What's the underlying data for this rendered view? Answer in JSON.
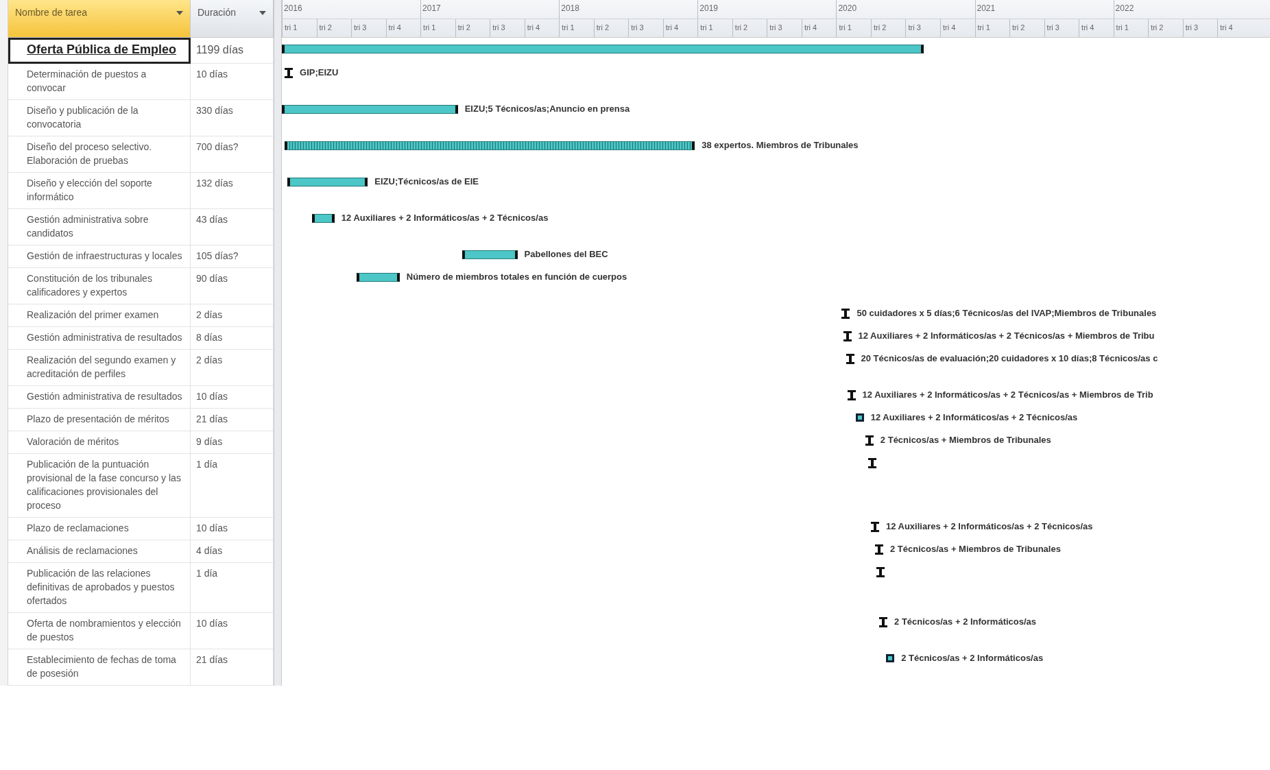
{
  "table": {
    "columns": [
      {
        "label": "Nombre de tarea",
        "selected": true
      },
      {
        "label": "Duración",
        "selected": false
      }
    ]
  },
  "timescale": {
    "years": [
      {
        "label": "2016",
        "quarters": [
          "tri 1",
          "tri 2",
          "tri 3",
          "tri 4"
        ]
      },
      {
        "label": "2017",
        "quarters": [
          "tri 1",
          "tri 2",
          "tri 3",
          "tri 4"
        ]
      },
      {
        "label": "2018",
        "quarters": [
          "tri 1",
          "tri 2",
          "tri 3",
          "tri 4"
        ]
      },
      {
        "label": "2019",
        "quarters": [
          "tri 1",
          "tri 2",
          "tri 3",
          "tri 4"
        ]
      },
      {
        "label": "2020",
        "quarters": [
          "tri 1",
          "tri 2",
          "tri 3",
          "tri 4"
        ]
      },
      {
        "label": "2021",
        "quarters": [
          "tri 1",
          "tri 2",
          "tri 3",
          "tri 4"
        ]
      },
      {
        "label": "2022",
        "quarters": [
          "tri 1",
          "tri 2",
          "tri 3",
          "tri 4"
        ]
      }
    ]
  },
  "tasks": [
    {
      "name": "Oferta Pública de Empleo",
      "duration": "1199 días",
      "kind": "summary",
      "selected": true
    },
    {
      "name": "Determinación de puestos a convocar",
      "duration": "10 días",
      "kind": "short",
      "resources": "GIP;EIZU",
      "selected": false
    },
    {
      "name": "Diseño y publicación de la convocatoria",
      "duration": "330 días",
      "kind": "task",
      "resources": "EIZU;5 Técnicos/as;Anuncio en prensa",
      "selected": false
    },
    {
      "name": "Diseño del proceso selectivo. Elaboración de pruebas",
      "duration": "700 días?",
      "kind": "hatched",
      "resources": "38 expertos. Miembros de Tribunales",
      "selected": false
    },
    {
      "name": "Diseño y elección del soporte informático",
      "duration": "132 días",
      "kind": "task",
      "resources": "EIZU;Técnicos/as de EIE",
      "selected": false
    },
    {
      "name": "Gestión administrativa sobre candidatos",
      "duration": "43 días",
      "kind": "task",
      "resources": "12 Auxiliares + 2 Informáticos/as + 2 Técnicos/as",
      "selected": false
    },
    {
      "name": "Gestión de infraestructuras y locales",
      "duration": "105 días?",
      "kind": "task",
      "resources": "Pabellones del BEC",
      "selected": false
    },
    {
      "name": "Constitución de los tribunales calificadores y expertos",
      "duration": "90 días",
      "kind": "task",
      "resources": "Número de miembros totales en función de cuerpos",
      "selected": false
    },
    {
      "name": "Realización del primer examen",
      "duration": "2 días",
      "kind": "short",
      "resources": "50 cuidadores x 5 días;6 Técnicos/as del IVAP;Miembros de Tribunales",
      "selected": false
    },
    {
      "name": "Gestión administrativa de resultados",
      "duration": "8 días",
      "kind": "short",
      "resources": "12 Auxiliares + 2 Informáticos/as + 2 Técnicos/as + Miembros de Tribu",
      "selected": false
    },
    {
      "name": "Realización del segundo examen y acreditación de perfiles",
      "duration": "2 días",
      "kind": "short",
      "resources": "20 Técnicos/as de evaluación;20 cuidadores x 10 días;8 Técnicos/as c",
      "selected": false
    },
    {
      "name": "Gestión administrativa de resultados",
      "duration": "10 días",
      "kind": "short",
      "resources": "12 Auxiliares + 2 Informáticos/as + 2 Técnicos/as + Miembros de Trib",
      "selected": false
    },
    {
      "name": "Plazo de presentación de méritos",
      "duration": "21 días",
      "kind": "box",
      "resources": "12 Auxiliares + 2 Informáticos/as + 2 Técnicos/as",
      "selected": false
    },
    {
      "name": "Valoración de méritos",
      "duration": "9 días",
      "kind": "short",
      "resources": "2 Técnicos/as + Miembros de Tribunales",
      "selected": false
    },
    {
      "name": "Publicación de la puntuación provisional de la fase concurso y las calificaciones provisionales del proceso",
      "duration": "1 día",
      "kind": "short",
      "selected": false
    },
    {
      "name": "Plazo de reclamaciones",
      "duration": "10 días",
      "kind": "short",
      "resources": "12 Auxiliares + 2 Informáticos/as + 2 Técnicos/as",
      "selected": false
    },
    {
      "name": "Análisis de reclamaciones",
      "duration": "4 días",
      "kind": "short",
      "resources": "2 Técnicos/as + Miembros de Tribunales",
      "selected": false
    },
    {
      "name": "Publicación de las relaciones definitivas de aprobados y puestos ofertados",
      "duration": "1 día",
      "kind": "short",
      "selected": false
    },
    {
      "name": "Oferta de nombramientos y elección de puestos",
      "duration": "10 días",
      "kind": "short",
      "resources": "2 Técnicos/as + 2 Informáticos/as",
      "selected": false
    },
    {
      "name": "Establecimiento de fechas de toma de posesión",
      "duration": "21 días",
      "kind": "box",
      "resources": "2 Técnicos/as + 2 Informáticos/as",
      "selected": false
    }
  ]
}
